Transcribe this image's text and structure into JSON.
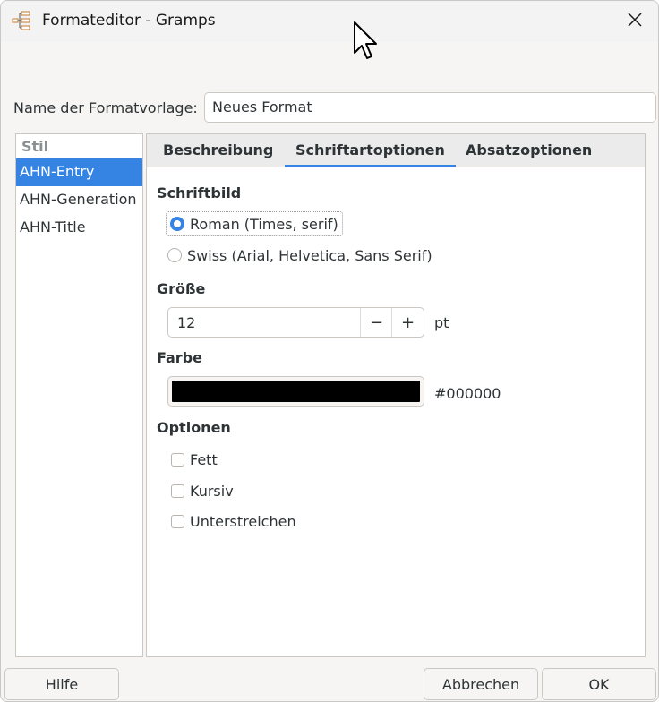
{
  "window": {
    "title": "Formateditor - Gramps"
  },
  "name_row": {
    "label": "Name der Formatvorlage:",
    "value": "Neues Format"
  },
  "style_list": {
    "header": "Stil",
    "items": [
      {
        "label": "AHN-Entry",
        "selected": true
      },
      {
        "label": "AHN-Generation",
        "selected": false
      },
      {
        "label": "AHN-Title",
        "selected": false
      }
    ]
  },
  "tabs": [
    {
      "label": "Beschreibung",
      "active": false
    },
    {
      "label": "Schriftartoptionen",
      "active": true
    },
    {
      "label": "Absatzoptionen",
      "active": false
    }
  ],
  "font_options": {
    "typeface_heading": "Schriftbild",
    "typefaces": [
      {
        "label": "Roman (Times, serif)",
        "selected": true
      },
      {
        "label": "Swiss (Arial, Helvetica, Sans Serif)",
        "selected": false
      }
    ],
    "size_heading": "Größe",
    "size_value": "12",
    "size_decrement": "−",
    "size_increment": "+",
    "size_unit": "pt",
    "color_heading": "Farbe",
    "color_value": "#000000",
    "color_hex_label": "#000000",
    "options_heading": "Optionen",
    "options": [
      {
        "label": "Fett",
        "checked": false
      },
      {
        "label": "Kursiv",
        "checked": false
      },
      {
        "label": "Unterstreichen",
        "checked": false
      }
    ]
  },
  "buttons": {
    "help": "Hilfe",
    "cancel": "Abbrechen",
    "ok": "OK"
  },
  "icons": {
    "app": "gramps-tree-icon",
    "close": "close-icon",
    "cursor": "mouse-pointer-icon"
  },
  "colors": {
    "accent": "#3584e4",
    "window_bg": "#f6f5f4"
  }
}
